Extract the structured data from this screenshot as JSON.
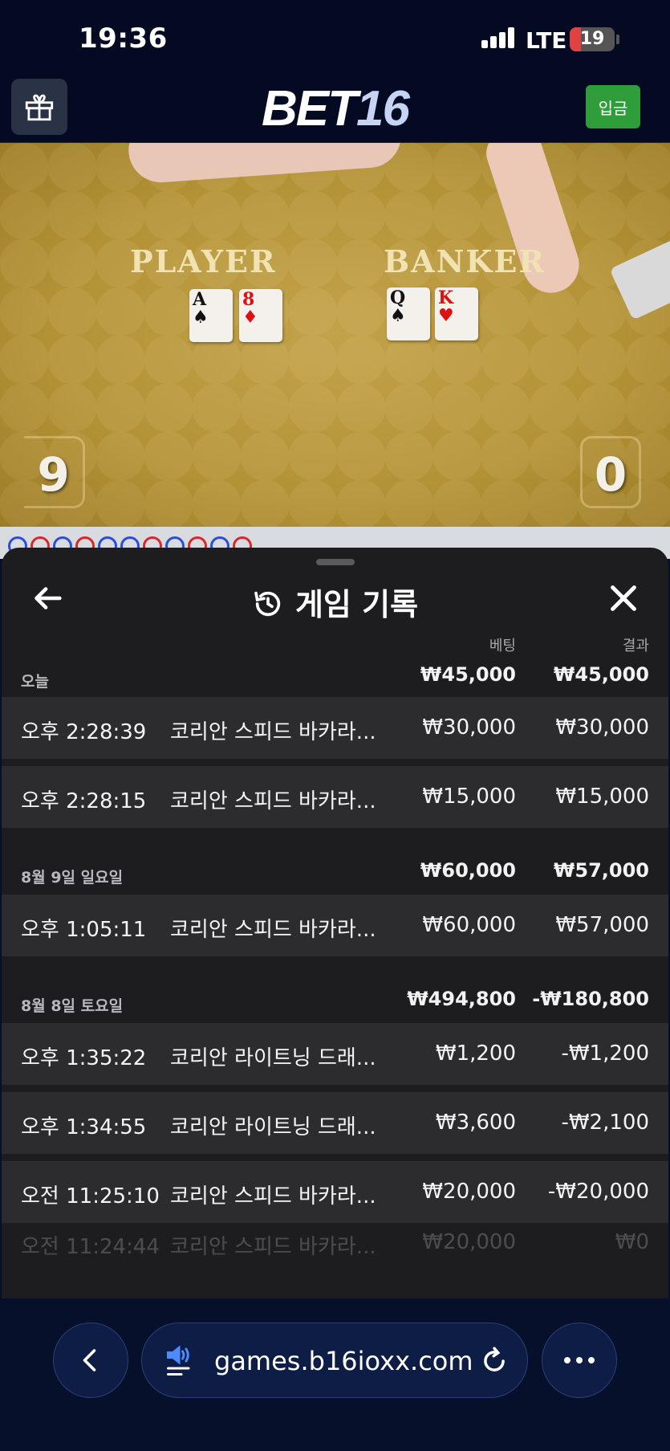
{
  "status_bar": {
    "time": "19:36",
    "network": "LTE",
    "battery": "19"
  },
  "app_bar": {
    "logo_part1": "BET",
    "logo_part2": "16",
    "deposit_label": "입금"
  },
  "game_view": {
    "player_label": "PLAYER",
    "banker_label": "BANKER",
    "player_cards": [
      {
        "rank": "A",
        "suit": "♠"
      },
      {
        "rank": "8",
        "suit": "♦"
      }
    ],
    "banker_cards": [
      {
        "rank": "Q",
        "suit": "♠"
      },
      {
        "rank": "K",
        "suit": "♥"
      }
    ],
    "player_score": "9",
    "banker_score": "0"
  },
  "sheet": {
    "title": "게임 기록",
    "col_bet": "베팅",
    "col_result": "결과",
    "groups": [
      {
        "date": "오늘",
        "bet_total": "₩45,000",
        "result_total": "₩45,000",
        "rows": [
          {
            "time": "오후 2:28:39",
            "game": "코리안 스피드 바카라...",
            "bet": "₩30,000",
            "result": "₩30,000"
          },
          {
            "time": "오후 2:28:15",
            "game": "코리안 스피드 바카라...",
            "bet": "₩15,000",
            "result": "₩15,000"
          }
        ]
      },
      {
        "date": "8월 9일 일요일",
        "bet_total": "₩60,000",
        "result_total": "₩57,000",
        "rows": [
          {
            "time": "오후 1:05:11",
            "game": "코리안 스피드 바카라...",
            "bet": "₩60,000",
            "result": "₩57,000"
          }
        ]
      },
      {
        "date": "8월 8일 토요일",
        "bet_total": "₩494,800",
        "result_total": "-₩180,800",
        "rows": [
          {
            "time": "오후 1:35:22",
            "game": "코리안 라이트닝 드래...",
            "bet": "₩1,200",
            "result": "-₩1,200"
          },
          {
            "time": "오후 1:34:55",
            "game": "코리안 라이트닝 드래...",
            "bet": "₩3,600",
            "result": "-₩2,100"
          },
          {
            "time": "오전 11:25:10",
            "game": "코리안 스피드 바카라...",
            "bet": "₩20,000",
            "result": "-₩20,000"
          },
          {
            "time": "오전 11:24:44",
            "game": "코리안 스피드 바카라...",
            "bet": "₩20,000",
            "result": "₩0"
          }
        ]
      }
    ]
  },
  "browser": {
    "url": "games.b16ioxx.com"
  },
  "icons": {
    "gift": "gift-icon",
    "history": "history-icon",
    "back": "arrow-left-icon",
    "close": "close-icon",
    "nav_back": "chevron-left-icon",
    "speaker": "speaker-icon",
    "reload": "reload-icon",
    "more": "more-icon"
  },
  "colors": {
    "deposit_green": "#2f9e3a",
    "sheet_bg": "#1d1d1f",
    "row_bg": "#2c2c2e",
    "browser_bg": "#06102a"
  }
}
